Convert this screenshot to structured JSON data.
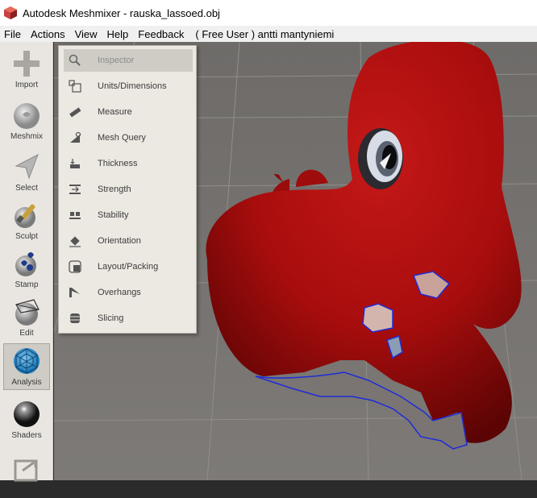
{
  "window": {
    "title": "Autodesk Meshmixer - rauska_lassoed.obj"
  },
  "menu": {
    "file": "File",
    "actions": "Actions",
    "view": "View",
    "help": "Help",
    "feedback": "Feedback",
    "user": "( Free User ) antti mantyniemi"
  },
  "toolbar": {
    "import": "Import",
    "meshmix": "Meshmix",
    "select": "Select",
    "sculpt": "Sculpt",
    "stamp": "Stamp",
    "edit": "Edit",
    "analysis": "Analysis",
    "shaders": "Shaders"
  },
  "analysis_menu": {
    "inspector": "Inspector",
    "units": "Units/Dimensions",
    "measure": "Measure",
    "mesh_query": "Mesh Query",
    "thickness": "Thickness",
    "strength": "Strength",
    "stability": "Stability",
    "orientation": "Orientation",
    "layout": "Layout/Packing",
    "overhangs": "Overhangs",
    "slicing": "Slicing"
  },
  "colors": {
    "model": "#a80d0d",
    "selection_outline": "#1f2cd8",
    "active_tool": "#cfcbc5"
  }
}
